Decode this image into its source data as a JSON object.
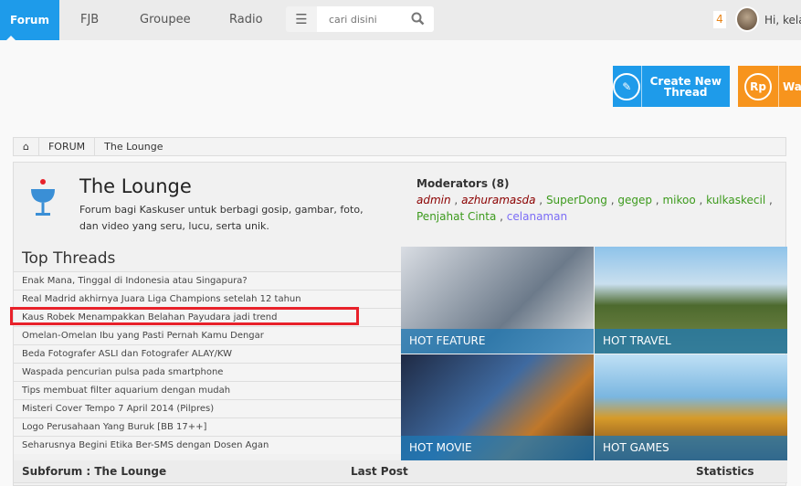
{
  "nav": {
    "tabs": [
      "Forum",
      "FJB",
      "Groupee",
      "Radio"
    ],
    "search_placeholder": "cari disini",
    "notif_count": "4",
    "greeting": "Hi, kela"
  },
  "actions": {
    "create_thread": "Create New Thread",
    "wallet": "Wa",
    "wallet_icon": "Rp"
  },
  "breadcrumb": [
    "FORUM",
    "The Lounge"
  ],
  "forum": {
    "title": "The Lounge",
    "description": "Forum bagi Kaskuser untuk berbagi gosip, gambar, foto, dan video yang seru, lucu, serta unik."
  },
  "moderators": {
    "label": "Moderators (8)",
    "list": [
      {
        "name": "admin",
        "color": "#8b0000"
      },
      {
        "name": "azhuramasda",
        "color": "#8b0000"
      },
      {
        "name": "SuperDong",
        "color": "#3c9a1c"
      },
      {
        "name": "gegep",
        "color": "#3c9a1c"
      },
      {
        "name": "mikoo",
        "color": "#3c9a1c"
      },
      {
        "name": "kulkaskecil",
        "color": "#3c9a1c"
      },
      {
        "name": "Penjahat Cinta",
        "color": "#3c9a1c"
      },
      {
        "name": "celanaman",
        "color": "#7b6cf6"
      }
    ]
  },
  "top_threads": {
    "title": "Top Threads",
    "items": [
      "Enak Mana, Tinggal di Indonesia atau Singapura?",
      "Real Madrid akhirnya Juara Liga Champions setelah 12 tahun",
      "Kaus Robek Menampakkan Belahan Payudara jadi trend",
      "Omelan-Omelan Ibu yang Pasti Pernah Kamu Dengar",
      "Beda Fotografer ASLI dan Fotografer ALAY/KW",
      "Waspada pencurian pulsa pada smartphone",
      "Tips membuat filter aquarium dengan mudah",
      "Misteri Cover Tempo 7 April 2014 (Pilpres)",
      "Logo Perusahaan Yang Buruk [BB 17++]",
      "Seharusnya Begini Etika Ber-SMS dengan Dosen Agan"
    ]
  },
  "tiles": [
    "HOT FEATURE",
    "HOT TRAVEL",
    "HOT MOVIE",
    "HOT GAMES"
  ],
  "subforum": {
    "title": "Subforum : The Lounge",
    "last_post": "Last Post",
    "statistics": "Statistics"
  },
  "colors": {
    "primary": "#1e9bea",
    "orange": "#f7941d",
    "highlight": "#e8212a"
  }
}
